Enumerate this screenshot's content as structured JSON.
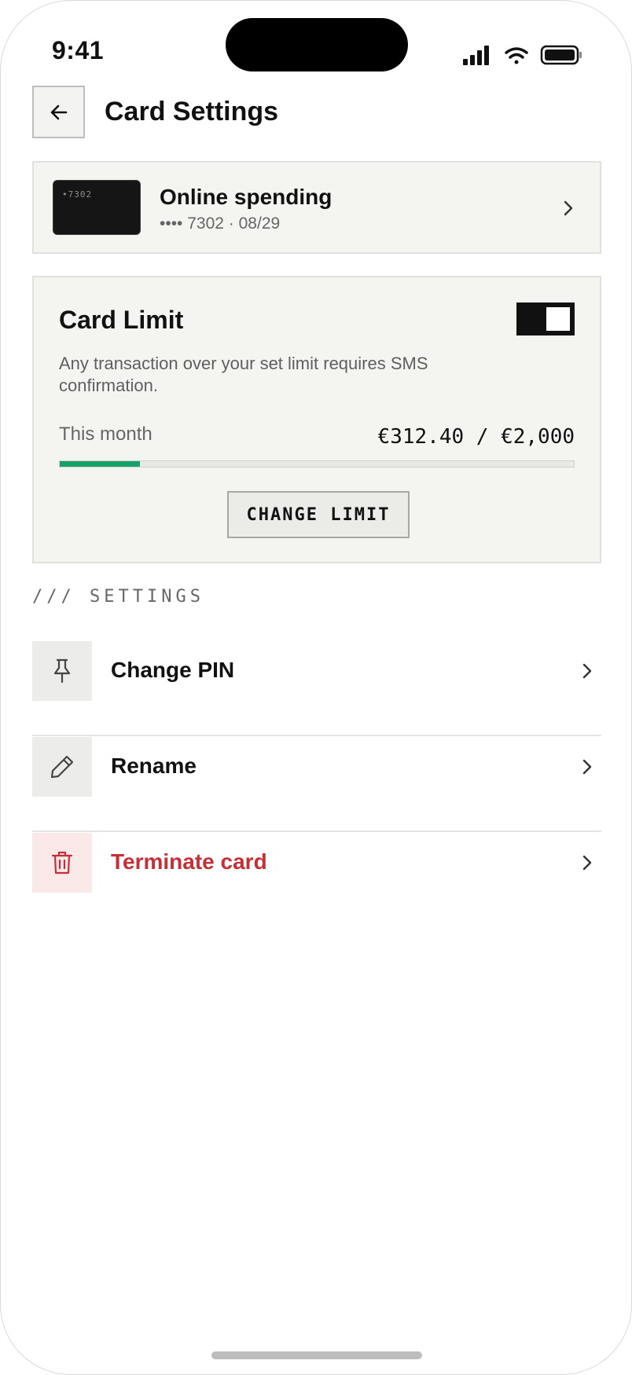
{
  "status_bar": {
    "time": "9:41"
  },
  "header": {
    "title": "Card Settings"
  },
  "card": {
    "name": "Online spending",
    "details": "•••• 7302 · 08/29",
    "thumb_text": "•7302"
  },
  "limit": {
    "title": "Card Limit",
    "enabled": true,
    "description": "Any transaction over your set limit requires SMS confirmation.",
    "period_label": "This month",
    "usage_text": "€312.40 / €2,000",
    "spent": 312.4,
    "limit_amount": 2000,
    "button_label": "CHANGE LIMIT"
  },
  "settings": {
    "section_label": "/// SETTINGS",
    "items": [
      {
        "label": "Change PIN",
        "icon": "pin-icon"
      },
      {
        "label": "Rename",
        "icon": "pencil-icon"
      },
      {
        "label": "Terminate card",
        "icon": "trash-icon",
        "danger_color": "#c62f36"
      }
    ]
  },
  "colors": {
    "accent_progress": "#16a06a",
    "danger": "#c62f36"
  }
}
